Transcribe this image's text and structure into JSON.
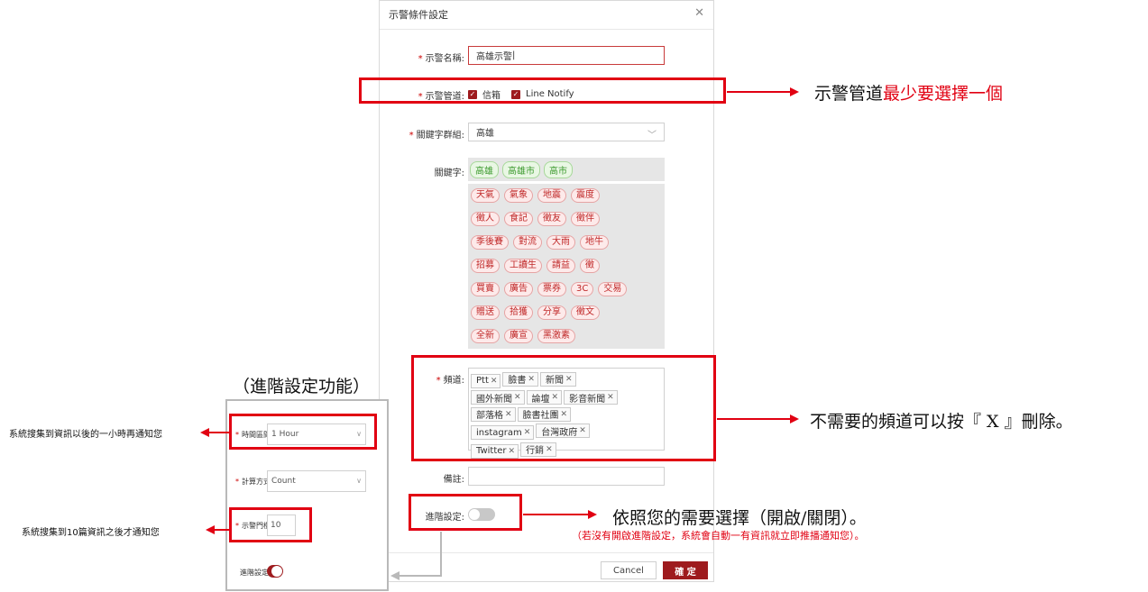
{
  "dialog": {
    "title": "示警條件設定",
    "close_icon": "close-icon",
    "name_label": "示警名稱:",
    "name_value": "高雄示警",
    "channel_label": "示警管道:",
    "channels": [
      "信箱",
      "Line Notify"
    ],
    "group_label": "關鍵字群組:",
    "group_value": "高雄",
    "keyword_label": "關鍵字:",
    "keywords_include": [
      "高雄",
      "高雄市",
      "高市"
    ],
    "keywords_exclude_rows": [
      [
        "天氣",
        "氣象",
        "地震",
        "震度"
      ],
      [
        "徵人",
        "食記",
        "徵友",
        "徵伴"
      ],
      [
        "季後賽",
        "對流",
        "大雨",
        "地牛"
      ],
      [
        "招募",
        "工讀生",
        "請益",
        "徵"
      ],
      [
        "買賣",
        "廣告",
        "票券",
        "3C",
        "交易"
      ],
      [
        "贈送",
        "拾獲",
        "分享",
        "徵文"
      ],
      [
        "全新",
        "廣宣",
        "黑激素"
      ]
    ],
    "source_label": "頻道:",
    "sources_rows": [
      [
        "Ptt",
        "臉書",
        "新聞"
      ],
      [
        "國外新聞",
        "論壇",
        "影音新聞"
      ],
      [
        "部落格",
        "臉書社團"
      ],
      [
        "instagram",
        "台灣政府"
      ],
      [
        "Twitter",
        "行銷"
      ]
    ],
    "remark_label": "備註:",
    "advanced_label": "進階設定:",
    "cancel_label": "Cancel",
    "confirm_label": "確 定"
  },
  "side_panel": {
    "title": "（進階設定功能）",
    "interval_label": "時間區間:",
    "interval_value": "1 Hour",
    "calc_label": "計算方式:",
    "calc_value": "Count",
    "threshold_label": "示警門檻:",
    "threshold_value": "10",
    "advanced_label": "進階設定:"
  },
  "annotations": {
    "channel_note_prefix": "示警管道",
    "channel_note_red": "最少要選擇一個",
    "source_note": "不需要的頻道可以按『 X 』刪除。",
    "advanced_note": "依照您的需要選擇（開啟/關閉）。",
    "advanced_sub_note": "（若沒有開啟進階設定，系統會自動一有資訊就立即推播通知您）。",
    "interval_note": "系統搜集到資訊以後的一小時再通知您",
    "threshold_note": "系統搜集到10篇資訊之後才通知您"
  },
  "colors": {
    "brand": "#9e1b1e",
    "annotation_red": "#e10012",
    "keyword_green": "#3c9a2e",
    "keyword_red": "#c02828"
  }
}
